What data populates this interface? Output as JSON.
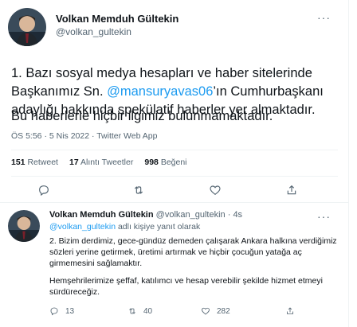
{
  "main_tweet": {
    "author_name": "Volkan Memduh Gültekin",
    "author_handle": "@volkan_gultekin",
    "text_before_mention": "1. Bazı sosyal medya hesapları ve haber sitelerinde Başkanımız Sn. ",
    "mention": "@mansuryavas06",
    "text_after_mention": "’ın Cumhurbaşkanı adaylığı hakkında spekülatif haberler yer almaktadır.",
    "text_second": "Bu haberlerle hiçbir ilgimiz bulunmamaktadır.",
    "meta": "ÖS 5:56 · 5 Nis 2022 · Twitter Web App",
    "stats": [
      {
        "value": "151",
        "label": "Retweet"
      },
      {
        "value": "17",
        "label": "Alıntı Tweetler"
      },
      {
        "value": "998",
        "label": "Beğeni"
      }
    ],
    "more": "···"
  },
  "reply": {
    "author_name": "Volkan Memduh Gültekin",
    "author_handle": "@volkan_gultekin",
    "time": "· 4s",
    "reply_to_handle": "@volkan_gultekin",
    "reply_to_suffix": " adlı kişiye yanıt olarak",
    "text_first": "2. Bizim derdimiz, gece-gündüz demeden çalışarak Ankara halkına verdiğimiz sözleri yerine getirmek,  üretimi artırmak ve hiçbir çocuğun yatağa aç girmemesini sağlamaktır.",
    "text_second": "Hemşehrilerimize şeffaf, katılımcı ve hesap verebilir şekilde hizmet etmeyi sürdüreceğiz.",
    "counts": {
      "reply": "13",
      "retweet": "40",
      "like": "282"
    },
    "more": "···"
  },
  "icons": [
    "reply-icon",
    "retweet-icon",
    "like-icon",
    "share-icon",
    "more-icon"
  ],
  "colors": {
    "accent": "#1d9bf0",
    "secondary_text": "#536471",
    "divider": "#eff3f4"
  }
}
